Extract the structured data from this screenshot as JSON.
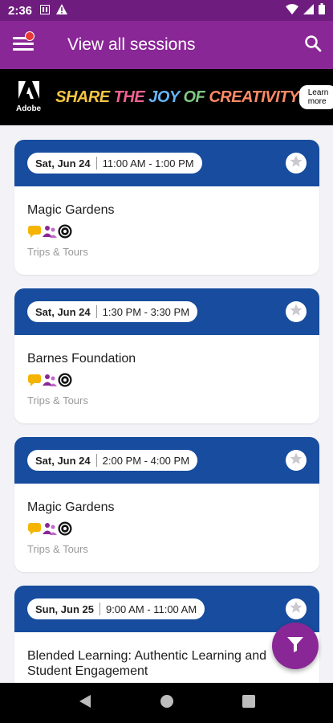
{
  "status_bar": {
    "time": "2:36"
  },
  "app_bar": {
    "title": "View all sessions"
  },
  "ad": {
    "brand": "Adobe",
    "headline": {
      "p1": "SHARE",
      "p2": " THE ",
      "p3": "JOY",
      "p4": " OF ",
      "p5": "CREATIVITY"
    },
    "cta": "Learn more"
  },
  "sessions": [
    {
      "date": "Sat, Jun 24",
      "time": "11:00 AM - 1:00 PM",
      "title": "Magic Gardens",
      "category": "Trips & Tours"
    },
    {
      "date": "Sat, Jun 24",
      "time": "1:30 PM - 3:30 PM",
      "title": "Barnes Foundation",
      "category": "Trips & Tours"
    },
    {
      "date": "Sat, Jun 24",
      "time": "2:00 PM - 4:00 PM",
      "title": "Magic Gardens",
      "category": "Trips & Tours"
    },
    {
      "date": "Sun, Jun 25",
      "time": "9:00 AM - 11:00 AM",
      "title": "Blended Learning: Authentic Learning and Student Engagement",
      "category": ""
    }
  ],
  "colors": {
    "app_bar": "#8a2796",
    "status_bar": "#6e1d7e",
    "card_header": "#174c9e",
    "tag_chat": "#f5b400",
    "tag_people": "#8a2796"
  },
  "icons": [
    "menu-icon",
    "search-icon",
    "star-icon",
    "chat-icon",
    "people-icon",
    "target-icon",
    "filter-icon",
    "back-icon",
    "home-icon",
    "recents-icon"
  ]
}
